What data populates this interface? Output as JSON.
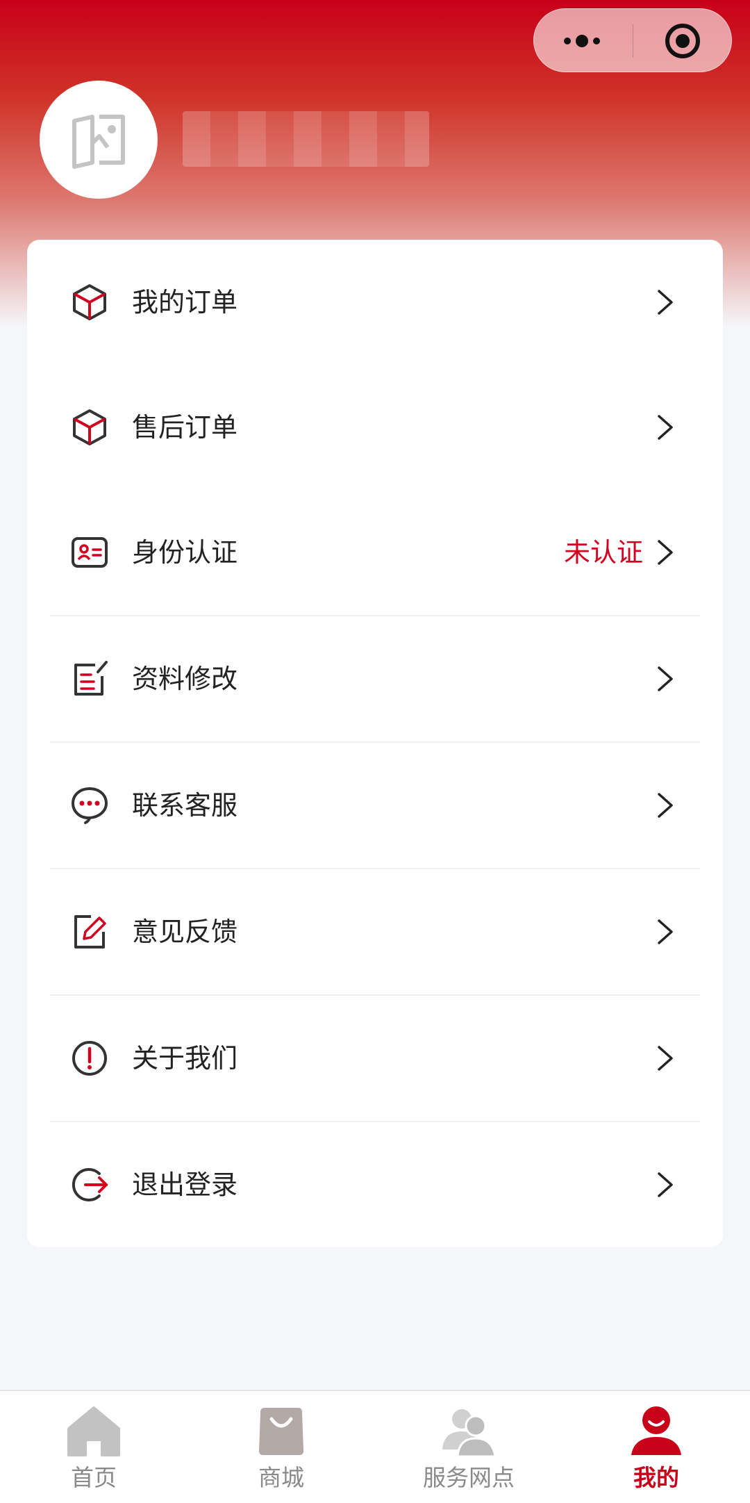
{
  "colors": {
    "accent": "#c8001a",
    "text": "#222222",
    "muted": "#8a8a8a",
    "background": "#f5f6fa"
  },
  "header": {
    "nickname": ""
  },
  "menu": [
    {
      "id": "my-orders",
      "label": "我的订单",
      "icon": "package-icon",
      "status": ""
    },
    {
      "id": "after-sales-orders",
      "label": "售后订单",
      "icon": "package-icon",
      "status": ""
    },
    {
      "id": "identity-verification",
      "label": "身份认证",
      "icon": "id-card-icon",
      "status": "未认证"
    },
    {
      "id": "edit-profile",
      "label": "资料修改",
      "icon": "edit-doc-icon",
      "status": ""
    },
    {
      "id": "contact-support",
      "label": "联系客服",
      "icon": "chat-bubble-icon",
      "status": ""
    },
    {
      "id": "feedback",
      "label": "意见反馈",
      "icon": "pencil-square-icon",
      "status": ""
    },
    {
      "id": "about-us",
      "label": "关于我们",
      "icon": "exclamation-circle-icon",
      "status": ""
    },
    {
      "id": "logout",
      "label": "退出登录",
      "icon": "logout-icon",
      "status": ""
    }
  ],
  "tabbar": [
    {
      "id": "home",
      "label": "首页",
      "icon": "home-icon",
      "active": false
    },
    {
      "id": "mall",
      "label": "商城",
      "icon": "shopping-bag-icon",
      "active": false
    },
    {
      "id": "service-points",
      "label": "服务网点",
      "icon": "users-icon",
      "active": false
    },
    {
      "id": "mine",
      "label": "我的",
      "icon": "user-icon",
      "active": true
    }
  ]
}
